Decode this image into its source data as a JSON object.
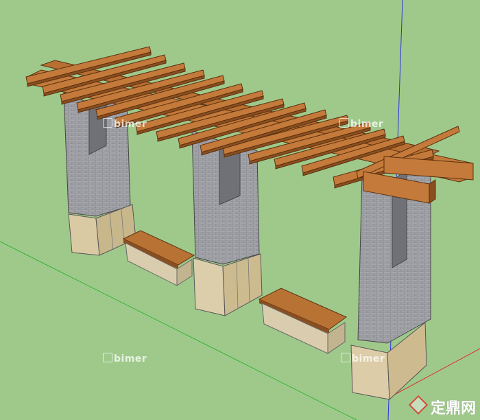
{
  "watermarks": [
    "bimer",
    "bimer",
    "bimer",
    "bimer"
  ],
  "site_logo": "定鼎网",
  "colors": {
    "ground": "#9fc98b",
    "timber": "#c47a3a",
    "timber_dark": "#8a4e1f",
    "brick": "#8e9096",
    "brick_light": "#a7a9ae",
    "stone": "#d8c9a3",
    "stone_dark": "#bba97d",
    "bench_top": "#b87334",
    "bench_base": "#d9cdae",
    "axis_red": "#e03030",
    "axis_green": "#2cb52c",
    "axis_blue": "#3030e0"
  }
}
